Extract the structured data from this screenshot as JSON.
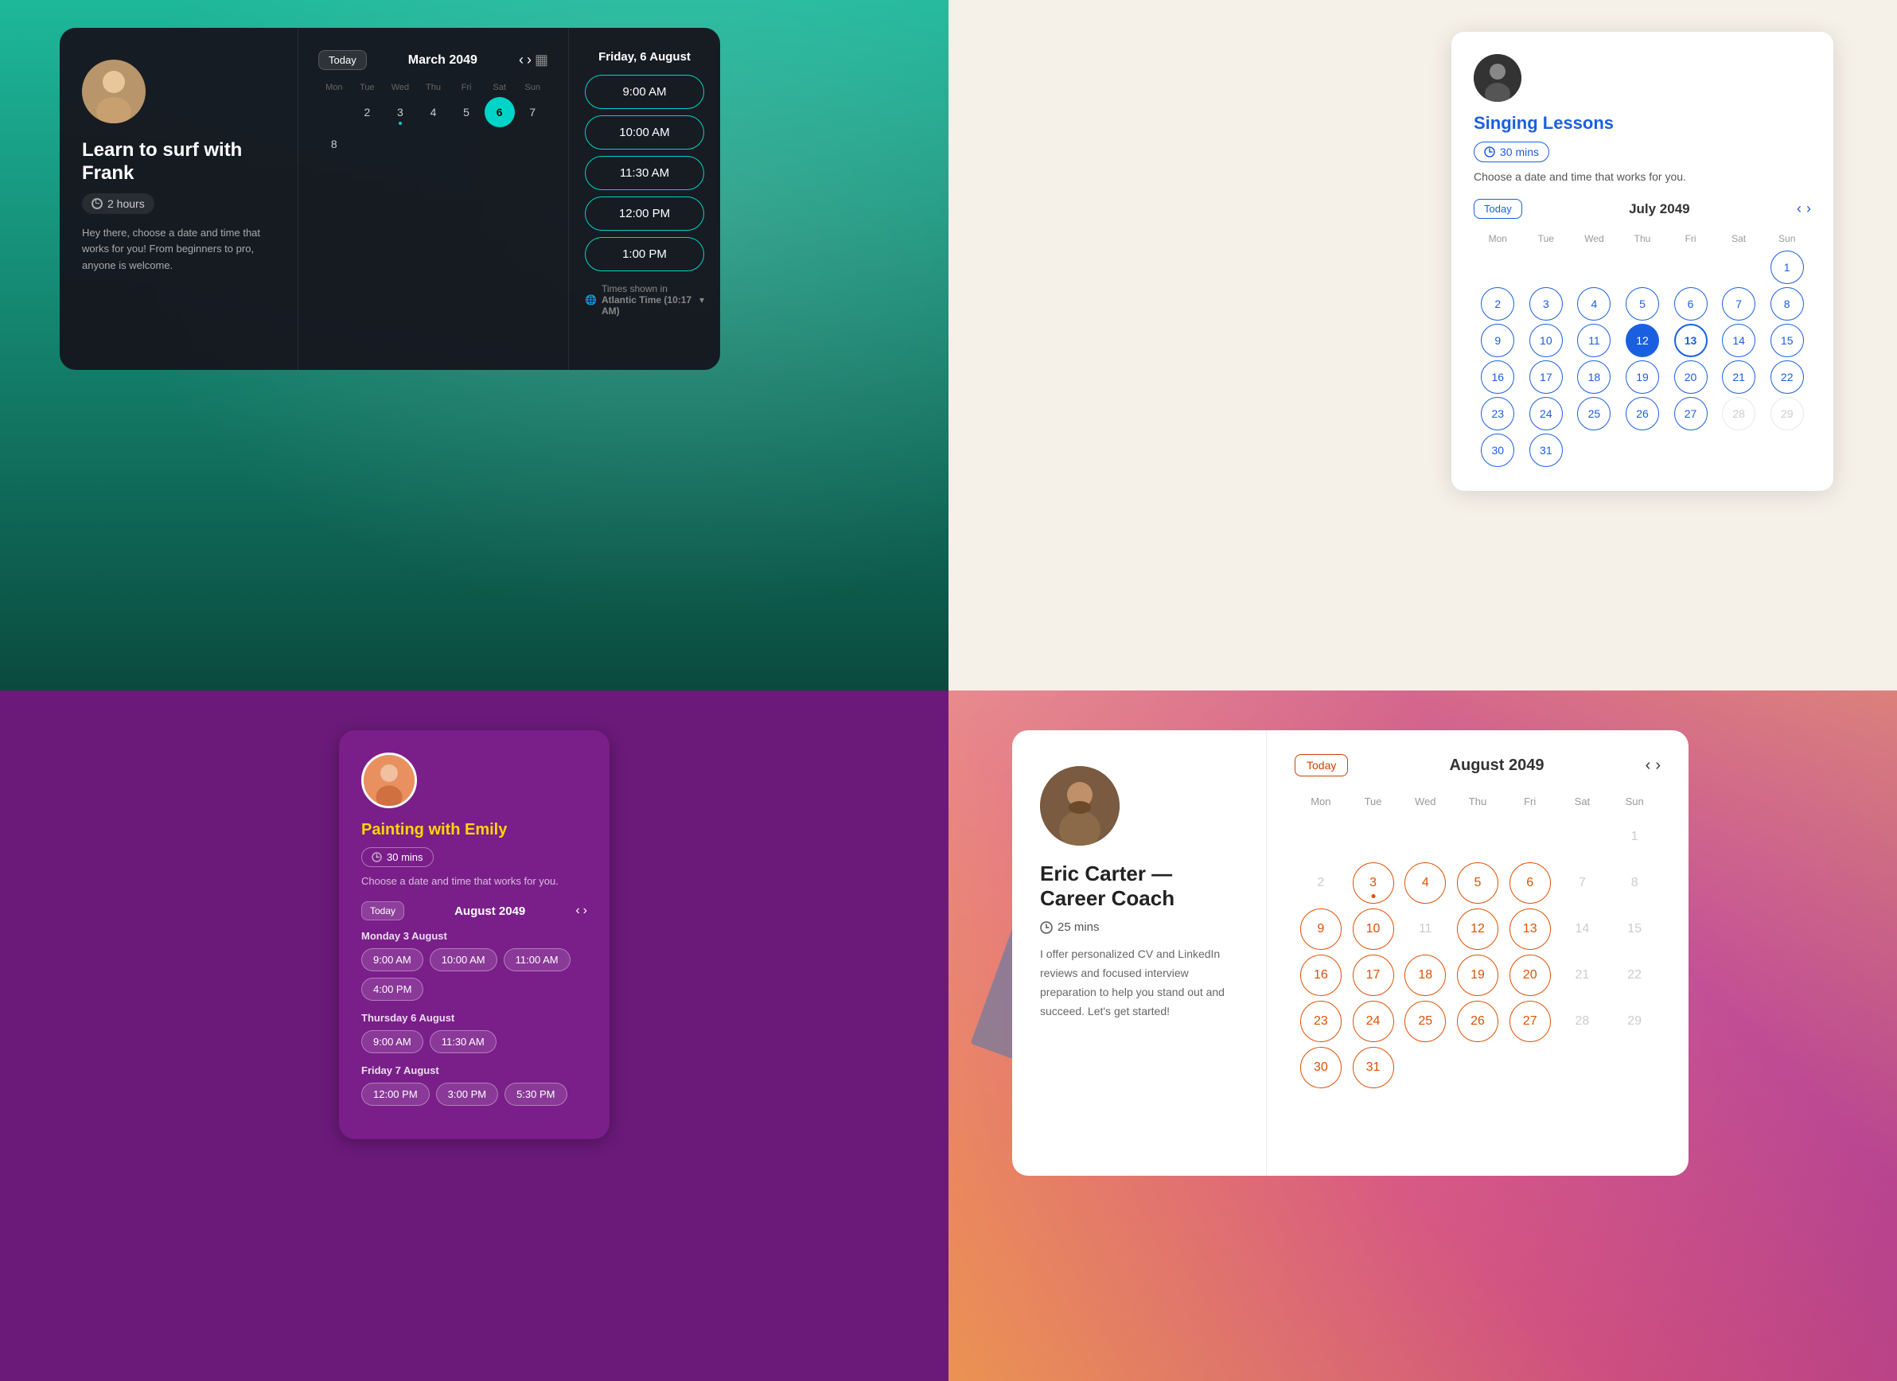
{
  "panels": {
    "topLeft": {
      "background": "ocean",
      "card": {
        "tutorName": "Learn to surf with Frank",
        "duration": "2 hours",
        "description": "Hey there, choose a date and time that works for you! From beginners to pro, anyone is welcome.",
        "calendar": {
          "todayBtn": "Today",
          "month": "March 2049",
          "calendarIcon": "calendar-icon",
          "prevBtn": "‹",
          "nextBtn": "›",
          "dayHeaders": [
            "Mon",
            "Tue",
            "Wed",
            "Thu",
            "Fri",
            "Sat",
            "Sun"
          ],
          "days": [
            {
              "num": "",
              "empty": true
            },
            {
              "num": "2"
            },
            {
              "num": "3",
              "hasDot": true
            },
            {
              "num": "4"
            },
            {
              "num": "5"
            },
            {
              "num": "6",
              "selected": true
            },
            {
              "num": "7"
            },
            {
              "num": "8"
            }
          ]
        },
        "timeslots": {
          "header": "Friday, 6 August",
          "times": [
            "9:00 AM",
            "10:00 AM",
            "11:30 AM",
            "12:00 PM",
            "1:00 PM"
          ],
          "timezone": "Times shown in Atlantic Time (10:17 AM)"
        }
      }
    },
    "topRight": {
      "background": "cream",
      "card": {
        "title": "Singing Lessons",
        "duration": "30 mins",
        "subtitle": "Choose a date and time that works for you.",
        "calendar": {
          "todayBtn": "Today",
          "month": "July 2049",
          "prevBtn": "‹",
          "nextBtn": "›",
          "dayHeaders": [
            "Mon",
            "Tue",
            "Wed",
            "Thu",
            "Fri",
            "Sat",
            "Sun"
          ],
          "weeks": [
            [
              {
                "num": "",
                "e": true
              },
              {
                "num": "",
                "e": true
              },
              {
                "num": "",
                "e": true
              },
              {
                "num": "",
                "e": true
              },
              {
                "num": "",
                "e": true
              },
              {
                "num": "",
                "e": true
              },
              {
                "num": "1",
                "a": true
              }
            ],
            [
              {
                "num": "2",
                "a": true
              },
              {
                "num": "3",
                "a": true
              },
              {
                "num": "4",
                "a": true
              },
              {
                "num": "5",
                "a": true
              },
              {
                "num": "6",
                "a": true
              },
              {
                "num": "7",
                "a": true
              },
              {
                "num": "8",
                "a": true
              }
            ],
            [
              {
                "num": "9",
                "a": true
              },
              {
                "num": "10",
                "a": true
              },
              {
                "num": "11",
                "a": true
              },
              {
                "num": "12",
                "today": true,
                "dot": true
              },
              {
                "num": "13",
                "today2": true
              },
              {
                "num": "14",
                "a": true
              },
              {
                "num": "15",
                "a": true
              }
            ],
            [
              {
                "num": "16",
                "a": true
              },
              {
                "num": "17",
                "a": true
              },
              {
                "num": "18",
                "a": true
              },
              {
                "num": "19",
                "a": true
              },
              {
                "num": "20",
                "a": true
              },
              {
                "num": "21",
                "a": true
              },
              {
                "num": "22",
                "a": true
              }
            ],
            [
              {
                "num": "23",
                "a": true
              },
              {
                "num": "24",
                "a": true
              },
              {
                "num": "25",
                "a": true
              },
              {
                "num": "26",
                "a": true
              },
              {
                "num": "27",
                "a": true
              },
              {
                "num": "28",
                "d": true
              },
              {
                "num": "29",
                "d": true
              }
            ],
            [
              {
                "num": "30",
                "a": true
              },
              {
                "num": "31",
                "a": true
              },
              {
                "num": "",
                "e": true
              },
              {
                "num": "",
                "e": true
              },
              {
                "num": "",
                "e": true
              },
              {
                "num": "",
                "e": true
              },
              {
                "num": "",
                "e": true
              }
            ]
          ]
        }
      }
    },
    "bottomLeft": {
      "background": "purple",
      "card": {
        "title": "Painting with Emily",
        "duration": "30 mins",
        "subtitle": "Choose a date and time that works for you.",
        "calendar": {
          "todayBtn": "Today",
          "month": "August 2049",
          "prevBtn": "‹",
          "nextBtn": "›"
        },
        "dateGroups": [
          {
            "label": "Monday 3 August",
            "slots": [
              "9:00 AM",
              "10:00 AM",
              "11:00 AM",
              "4:00 PM"
            ]
          },
          {
            "label": "Thursday 6 August",
            "slots": [
              "9:00 AM",
              "11:30 AM"
            ]
          },
          {
            "label": "Friday 7 August",
            "slots": [
              "12:00 PM",
              "3:00 PM",
              "5:30 PM"
            ]
          }
        ]
      }
    },
    "bottomRight": {
      "background": "abstract-art",
      "card": {
        "name": "Eric Carter — Career Coach",
        "duration": "25 mins",
        "description": "I offer personalized CV and LinkedIn reviews and focused interview preparation to help you stand out and succeed. Let's get started!",
        "calendar": {
          "todayBtn": "Today",
          "month": "August 2049",
          "prevBtn": "‹",
          "nextBtn": "›",
          "dayHeaders": [
            "Mon",
            "Tue",
            "Wed",
            "Thu",
            "Fri",
            "Sat",
            "Sun"
          ],
          "weeks": [
            [
              {
                "n": "",
                "e": true
              },
              {
                "n": "",
                "e": true
              },
              {
                "n": "",
                "e": true
              },
              {
                "n": "",
                "e": true
              },
              {
                "n": "",
                "e": true
              },
              {
                "n": "",
                "e": true
              },
              {
                "n": "1",
                "d": true
              }
            ],
            [
              {
                "n": "2",
                "d": true
              },
              {
                "n": "3",
                "a": true,
                "dot": true
              },
              {
                "n": "4",
                "a": true
              },
              {
                "n": "5",
                "a": true
              },
              {
                "n": "6",
                "a": true
              },
              {
                "n": "7",
                "d": true
              },
              {
                "n": "8",
                "d": true
              }
            ],
            [
              {
                "n": "9",
                "a": true
              },
              {
                "n": "10",
                "a": true
              },
              {
                "n": "11",
                "d": true
              },
              {
                "n": "12",
                "a": true
              },
              {
                "n": "13",
                "a": true
              },
              {
                "n": "14",
                "d": true
              },
              {
                "n": "15",
                "d": true
              }
            ],
            [
              {
                "n": "16",
                "a": true
              },
              {
                "n": "17",
                "a": true
              },
              {
                "n": "18",
                "a": true
              },
              {
                "n": "19",
                "a": true
              },
              {
                "n": "20",
                "a": true
              },
              {
                "n": "21",
                "d": true
              },
              {
                "n": "22",
                "d": true
              }
            ],
            [
              {
                "n": "23",
                "a": true
              },
              {
                "n": "24",
                "a": true
              },
              {
                "n": "25",
                "a": true
              },
              {
                "n": "26",
                "a": true
              },
              {
                "n": "27",
                "a": true
              },
              {
                "n": "28",
                "d": true
              },
              {
                "n": "29",
                "d": true
              }
            ],
            [
              {
                "n": "30",
                "a": true
              },
              {
                "n": "31",
                "a": true
              },
              {
                "n": "",
                "e": true
              },
              {
                "n": "",
                "e": true
              },
              {
                "n": "",
                "e": true
              },
              {
                "n": "",
                "e": true
              },
              {
                "n": "",
                "e": true
              }
            ]
          ]
        }
      }
    }
  },
  "icons": {
    "clock": "⏱",
    "globe": "🌐",
    "chevronDown": "▾",
    "chevronLeft": "‹",
    "chevronRight": "›",
    "calendar": "▦"
  }
}
